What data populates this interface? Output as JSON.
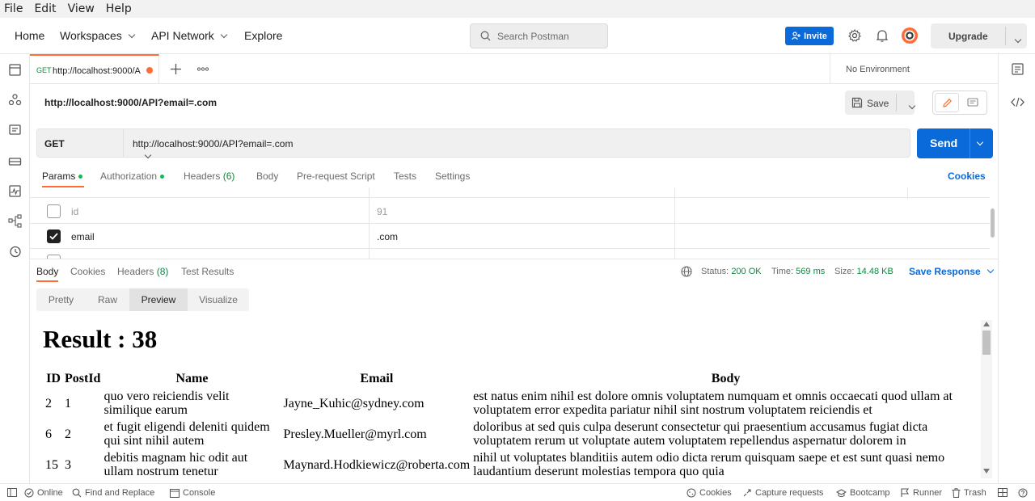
{
  "menubar": {
    "items": [
      "File",
      "Edit",
      "View",
      "Help"
    ]
  },
  "topnav": {
    "home": "Home",
    "workspaces": "Workspaces",
    "api_network": "API Network",
    "explore": "Explore",
    "search_placeholder": "Search Postman",
    "invite": "Invite",
    "upgrade": "Upgrade"
  },
  "tabs": {
    "active": {
      "method": "GET",
      "title": "http://localhost:9000/A"
    },
    "environment": "No Environment"
  },
  "request": {
    "title": "http://localhost:9000/API?email=.com",
    "save": "Save",
    "method": "GET",
    "url": "http://localhost:9000/API?email=.com",
    "send": "Send"
  },
  "request_tabs": {
    "params": "Params",
    "authorization": "Authorization",
    "headers": "Headers",
    "headers_count": "(6)",
    "body": "Body",
    "prerequest": "Pre-request Script",
    "tests": "Tests",
    "settings": "Settings",
    "cookies": "Cookies"
  },
  "params": [
    {
      "key": "id",
      "value": "91",
      "checked": false
    },
    {
      "key": "email",
      "value": ".com",
      "checked": true
    }
  ],
  "response": {
    "tabs": {
      "body": "Body",
      "cookies": "Cookies",
      "headers": "Headers",
      "headers_count": "(8)",
      "test_results": "Test Results"
    },
    "status_label": "Status:",
    "status": "200 OK",
    "time_label": "Time:",
    "time": "569 ms",
    "size_label": "Size:",
    "size": "14.48 KB",
    "save_response": "Save Response",
    "views": [
      "Pretty",
      "Raw",
      "Preview",
      "Visualize"
    ],
    "selected_view": "Preview"
  },
  "preview": {
    "heading": "Result : 38",
    "columns": [
      "ID",
      "PostId",
      "Name",
      "Email",
      "Body"
    ],
    "rows": [
      [
        "2",
        "1",
        "quo vero reiciendis velit similique earum",
        "Jayne_Kuhic@sydney.com",
        "est natus enim nihil est dolore omnis voluptatem numquam et omnis occaecati quod ullam at voluptatem error expedita pariatur nihil sint nostrum voluptatem reiciendis et"
      ],
      [
        "6",
        "2",
        "et fugit eligendi deleniti quidem qui sint nihil autem",
        "Presley.Mueller@myrl.com",
        "doloribus at sed quis culpa deserunt consectetur qui praesentium accusamus fugiat dicta voluptatem rerum ut voluptate autem voluptatem repellendus aspernatur dolorem in"
      ],
      [
        "15",
        "3",
        "debitis magnam hic odit aut ullam nostrum tenetur",
        "Maynard.Hodkiewicz@roberta.com",
        "nihil ut voluptates blanditiis autem odio dicta rerum quisquam saepe et est sunt quasi nemo laudantium deserunt molestias tempora quo quia"
      ]
    ]
  },
  "statusbar": {
    "online": "Online",
    "find_replace": "Find and Replace",
    "console": "Console",
    "cookies": "Cookies",
    "capture": "Capture requests",
    "bootcamp": "Bootcamp",
    "runner": "Runner",
    "trash": "Trash"
  },
  "colors": {
    "accent": "#0b6ad9",
    "orange": "#ff6c37",
    "success": "#0a8a3e"
  }
}
